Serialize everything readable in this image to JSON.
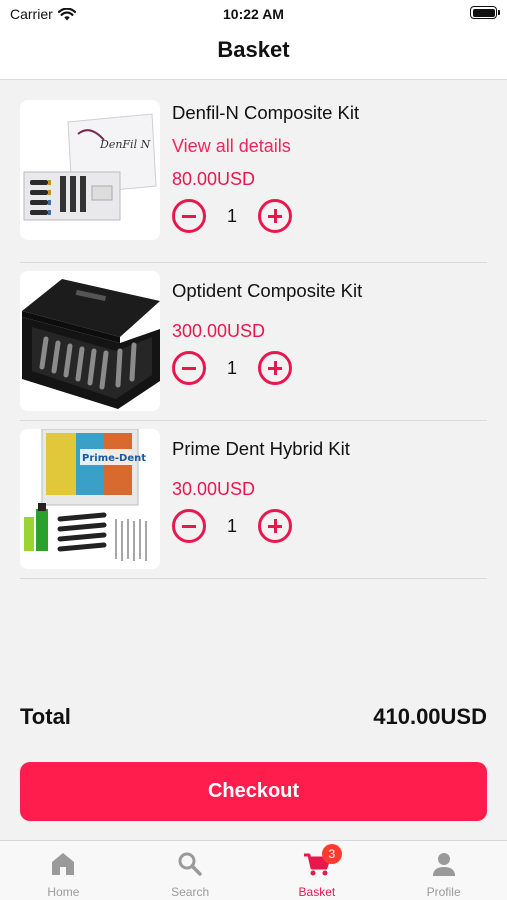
{
  "status_bar": {
    "carrier": "Carrier",
    "time": "10:22 AM"
  },
  "header": {
    "title": "Basket"
  },
  "items": [
    {
      "name": "Denfil-N Composite Kit",
      "details_link": "View all details",
      "price": "80.00USD",
      "quantity": "1",
      "image_text": "DenFil N"
    },
    {
      "name": "Optident Composite Kit",
      "price": "300.00USD",
      "quantity": "1"
    },
    {
      "name": "Prime Dent Hybrid Kit",
      "price": "30.00USD",
      "quantity": "1",
      "image_text": "Prime-Dent"
    }
  ],
  "summary": {
    "total_label": "Total",
    "total_value": "410.00USD"
  },
  "checkout": {
    "label": "Checkout"
  },
  "tab_bar": {
    "tabs": [
      {
        "label": "Home",
        "icon": "home-icon"
      },
      {
        "label": "Search",
        "icon": "search-icon"
      },
      {
        "label": "Basket",
        "icon": "cart-icon",
        "badge": "3"
      },
      {
        "label": "Profile",
        "icon": "user-icon"
      }
    ]
  },
  "colors": {
    "accent": "#e8184f",
    "checkout": "#ff1d4d",
    "badge": "#ff3b30",
    "inactive": "#9a9a9a"
  }
}
